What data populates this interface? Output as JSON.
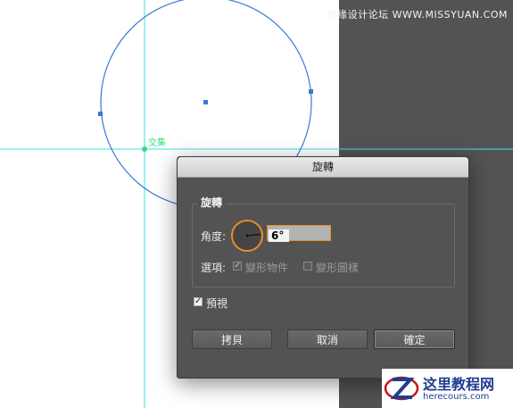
{
  "watermark_top": "思缘设计论坛 WWW.MISSYUAN.COM",
  "canvas": {
    "intersect_label": "交集"
  },
  "dialog": {
    "title": "旋轉",
    "group_label": "旋轉",
    "angle_label": "角度:",
    "angle_value": "6°",
    "options_label": "選項:",
    "option_transform_objects": {
      "label": "變形物件",
      "checked": true,
      "enabled": false
    },
    "option_transform_patterns": {
      "label": "變形圖樣",
      "checked": false,
      "enabled": false
    },
    "preview": {
      "label": "預視",
      "checked": true
    },
    "buttons": {
      "copy": "拷貝",
      "cancel": "取消",
      "ok": "確定"
    }
  },
  "logo": {
    "title": "这里教程网",
    "subtitle": "herecours.com"
  },
  "colors": {
    "guide": "#3ee3e8",
    "circle": "#3a78d4",
    "accent": "#e98c2a",
    "pasteboard": "#535353"
  }
}
